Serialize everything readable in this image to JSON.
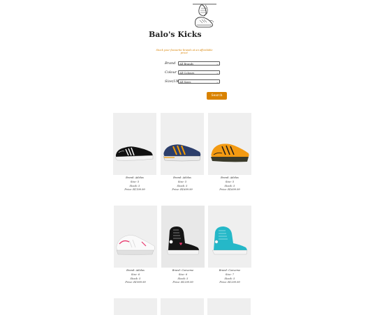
{
  "header": {
    "title": "Balo's Kicks",
    "tagline": "Stock your favourite brands at an affordable price!"
  },
  "filters": [
    {
      "label": "Brand",
      "value": "All Brands"
    },
    {
      "label": "Colour",
      "value": "All Colours"
    },
    {
      "label": "Size(UK)",
      "value": "All Sizes"
    }
  ],
  "search_label": "Search",
  "products": [
    {
      "brand": "Brand: Adidas",
      "size": "Size: 5",
      "stock": "Stock: 5",
      "price": "Price: R1199.99",
      "color": "black"
    },
    {
      "brand": "Brand: Adidas",
      "size": "Size: 5",
      "stock": "Stock: 5",
      "price": "Price: R1699.99",
      "color": "navy-orange"
    },
    {
      "brand": "Brand: Adidas",
      "size": "Size: 5",
      "stock": "Stock: 5",
      "price": "Price: R1699.99",
      "color": "orange"
    },
    {
      "brand": "Brand: Adidas",
      "size": "Size: 6",
      "stock": "Stock: 5",
      "price": "Price: R1999.99",
      "color": "white-pink"
    },
    {
      "brand": "Brand: Converse",
      "size": "Size: 6",
      "stock": "Stock: 5",
      "price": "Price: R1299.99",
      "color": "black-hightop"
    },
    {
      "brand": "Brand: Converse",
      "size": "Size: 7",
      "stock": "Stock: 5",
      "price": "Price: R1299.99",
      "color": "teal-hightop"
    }
  ],
  "colors": {
    "accent": "#d98200"
  }
}
